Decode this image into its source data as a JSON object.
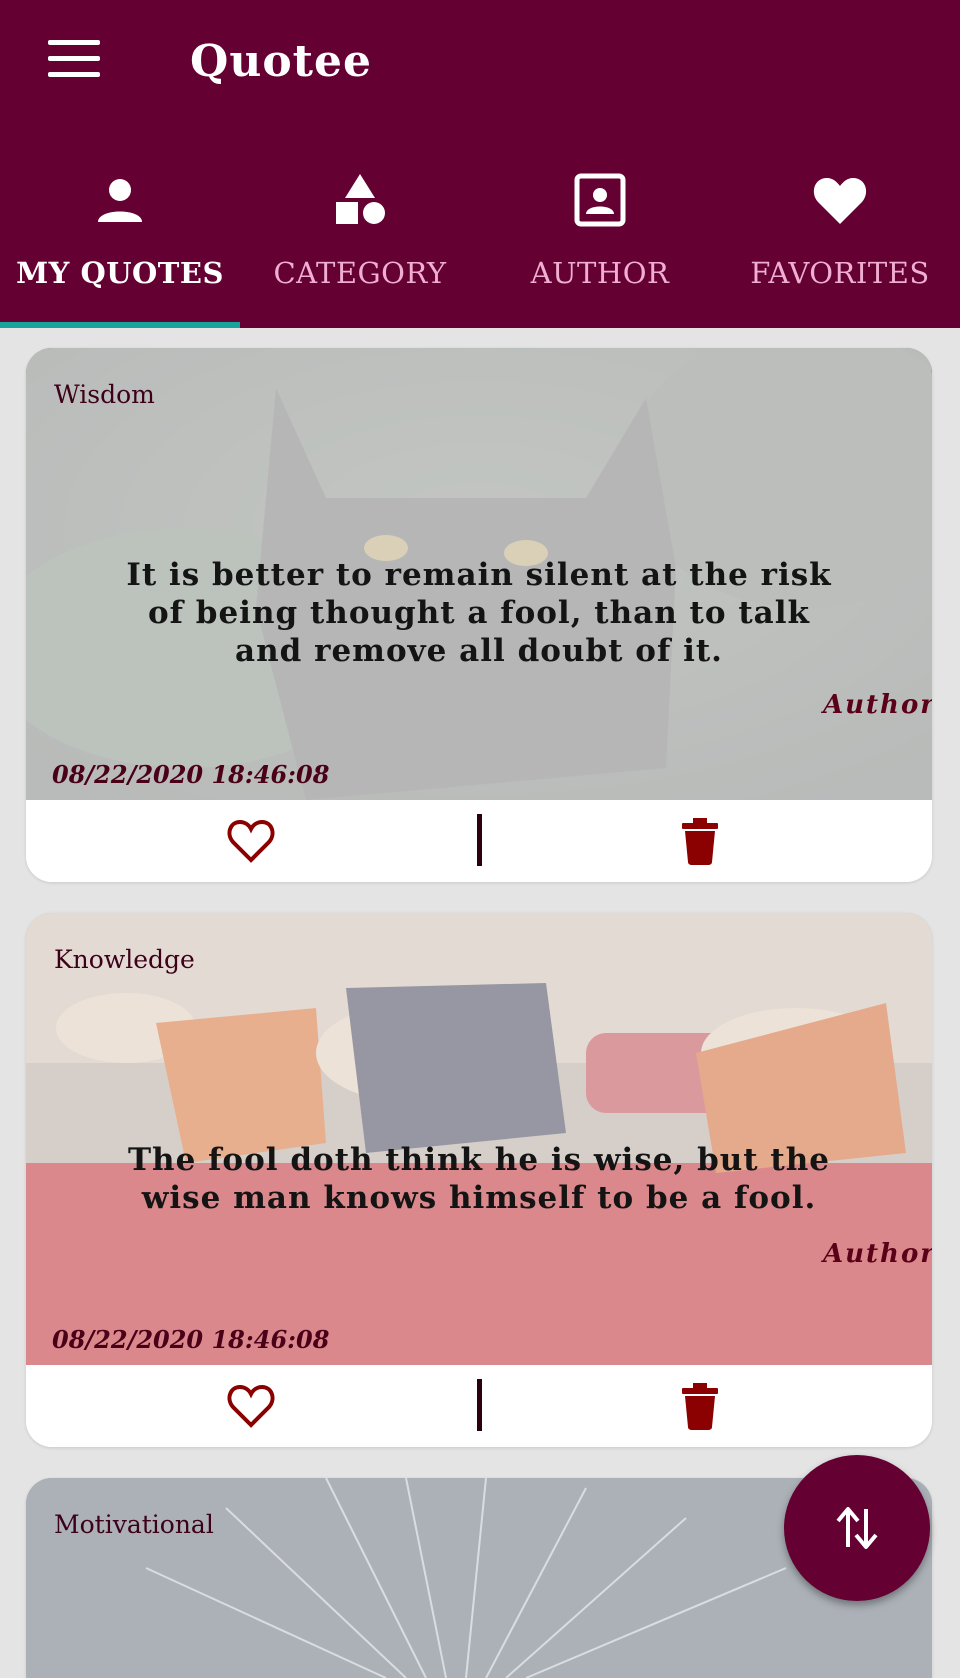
{
  "app": {
    "title": "Quotee"
  },
  "tabs": [
    {
      "label": "MY QUOTES",
      "icon": "person-icon",
      "active": true
    },
    {
      "label": "CATEGORY",
      "icon": "shapes-icon",
      "active": false
    },
    {
      "label": "AUTHOR",
      "icon": "contact-card-icon",
      "active": false
    },
    {
      "label": "FAVORITES",
      "icon": "heart-icon",
      "active": false
    }
  ],
  "quotes": [
    {
      "category": "Wisdom",
      "text": "It is better to remain silent at the risk of being thought a fool, than to talk and remove all doubt of it.",
      "author": "Author",
      "timestamp": "08/22/2020 18:46:08"
    },
    {
      "category": "Knowledge",
      "text": "The fool doth think he is wise, but the wise man knows himself to be a fool.",
      "author": "Author",
      "timestamp": "08/22/2020 18:46:08"
    },
    {
      "category": "Motivational"
    }
  ],
  "colors": {
    "primary": "#640032",
    "tab_indicator": "#1aa39a",
    "action_icon": "#8b0000",
    "background": "#e4e4e4"
  },
  "fab": {
    "icon": "sort-arrows-icon"
  }
}
